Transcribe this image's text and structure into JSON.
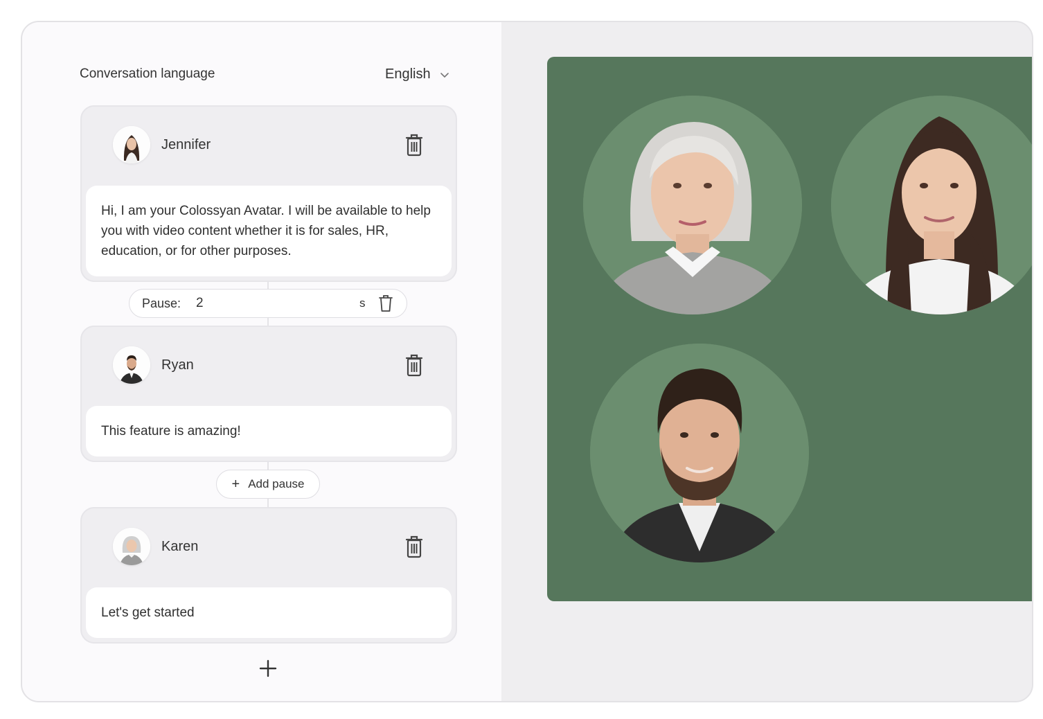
{
  "header": {
    "language_label": "Conversation language",
    "language_value": "English"
  },
  "speakers": [
    {
      "name": "Jennifer",
      "text": "Hi, I am your Colossyan Avatar. I will be available to help you with video content whether it is for sales, HR, education, or for other purposes."
    },
    {
      "name": "Ryan",
      "text": "This feature is amazing!"
    },
    {
      "name": "Karen",
      "text": "Let's get started"
    }
  ],
  "pause": {
    "label": "Pause:",
    "value": "2",
    "unit": "s"
  },
  "add_pause": {
    "label": "Add pause"
  },
  "colors": {
    "preview_bg": "#56775c",
    "portrait_bg": "#6b8e6f"
  }
}
